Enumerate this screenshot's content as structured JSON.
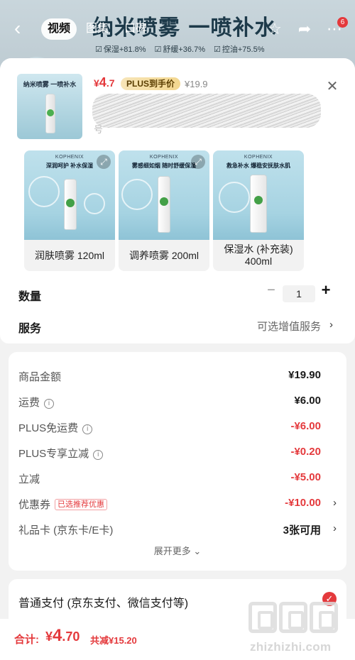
{
  "backdrop": {
    "banner_title": "纳米喷雾 一喷补水",
    "claims": [
      "保湿+81.8%",
      "舒缓+36.7%",
      "控油+75.5%"
    ]
  },
  "nav": {
    "tabs": [
      {
        "label": "视频",
        "active": true
      },
      {
        "label": "图集",
        "active": false
      },
      {
        "label": "口碑",
        "active": false
      }
    ],
    "more_badge": "6"
  },
  "product": {
    "thumb_title": "纳米喷雾 一喷补水",
    "price_symbol": "¥",
    "price_int": "4",
    "price_dec": ".7",
    "plus_tag": "PLUS到手价",
    "orig_price": "¥19.9",
    "faint_text": "号"
  },
  "variants": [
    {
      "brand": "KOPHENIX",
      "tag": "深润呵护 补水保湿",
      "label": "润肤喷雾 120ml"
    },
    {
      "brand": "KOPHENIX",
      "tag": "雾感细如烟 随时舒缓保湿",
      "label": "调养喷雾 200ml"
    },
    {
      "brand": "KOPHENIX",
      "tag": "救急补水 爆稳安抚肤水肌",
      "label": "保湿水 (补充装) 400ml"
    }
  ],
  "quantity": {
    "label": "数量",
    "minus": "−",
    "value": "1",
    "plus": "+"
  },
  "service": {
    "label": "服务",
    "value": "可选增值服务"
  },
  "breakdown": {
    "rows": [
      {
        "k": "商品金额",
        "v": "¥19.90",
        "red": false
      },
      {
        "k": "运费",
        "v": "¥6.00",
        "red": false,
        "info": true
      },
      {
        "k": "PLUS免运费",
        "v": "-¥6.00",
        "red": true,
        "info": true
      },
      {
        "k": "PLUS专享立减",
        "v": "-¥0.20",
        "red": true,
        "info": true
      },
      {
        "k": "立减",
        "v": "-¥5.00",
        "red": true
      },
      {
        "k": "优惠券",
        "v": "-¥10.00",
        "red": true,
        "tag": "已选推荐优惠",
        "arrow": true
      },
      {
        "k": "礼品卡 (京东卡/E卡)",
        "v": "3张可用",
        "red": false,
        "arrow": true
      }
    ],
    "expand_more": "展开更多 ⌄"
  },
  "payment": {
    "label": "普通支付 (京东支付、微信支付等)"
  },
  "bottom": {
    "total_label": "合计:",
    "total_symbol": "¥",
    "total_int": "4",
    "total_dec": ".70",
    "total_save": "共减¥15.20"
  },
  "watermark": {
    "text": "zhizhizhi.com"
  },
  "colors": {
    "accent": "#e4393c",
    "plus_gold": "#f3d78f"
  },
  "icons": [
    "back-arrow-icon",
    "star-icon",
    "share-icon",
    "more-icon",
    "close-icon",
    "expand-icon",
    "info-icon",
    "chevron-right-icon",
    "check-icon"
  ]
}
